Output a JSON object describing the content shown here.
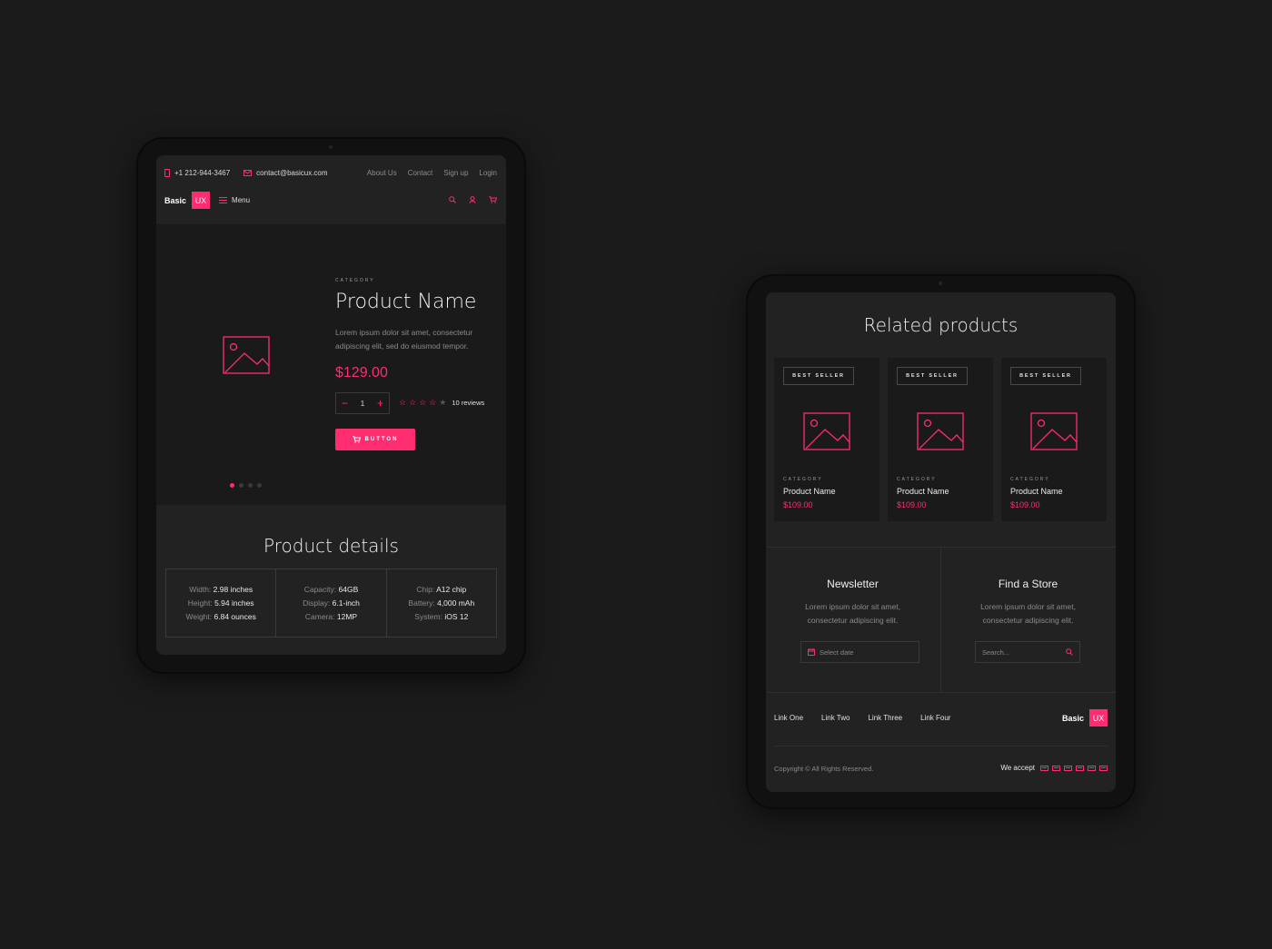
{
  "brand": {
    "basic": "Basic",
    "ux": "UX"
  },
  "accent_color": "#ff2d6f",
  "topbar": {
    "phone": "+1 212-944-3467",
    "email": "contact@basicux.com",
    "links": [
      "About Us",
      "Contact",
      "Sign up",
      "Login"
    ],
    "menu_label": "Menu",
    "icons": [
      "search-icon",
      "user-icon",
      "cart-icon"
    ]
  },
  "hero": {
    "category": "CATEGORY",
    "product_name": "Product Name",
    "description_line1": "Lorem ipsum dolor sit amet, consectetur",
    "description_line2": "adipiscing elit, sed do eiusmod tempor.",
    "price": "$129.00",
    "quantity": "1",
    "rating": 4,
    "rating_max": 5,
    "reviews": "10 reviews",
    "button_label": "BUTTON",
    "carousel_dots": 4,
    "carousel_active": 0
  },
  "details": {
    "title": "Product details",
    "columns": [
      [
        {
          "k": "Width:",
          "v": "2.98 inches"
        },
        {
          "k": "Height:",
          "v": "5.94 inches"
        },
        {
          "k": "Weight:",
          "v": "6.84 ounces"
        }
      ],
      [
        {
          "k": "Capacity:",
          "v": "64GB"
        },
        {
          "k": "Display:",
          "v": "6.1-inch"
        },
        {
          "k": "Camera:",
          "v": "12MP"
        }
      ],
      [
        {
          "k": "Chip:",
          "v": "A12 chip"
        },
        {
          "k": "Battery:",
          "v": "4,000 mAh"
        },
        {
          "k": "System:",
          "v": "iOS 12"
        }
      ]
    ]
  },
  "related": {
    "title": "Related products",
    "cards": [
      {
        "badge": "BEST SELLER",
        "category": "CATEGORY",
        "name": "Product Name",
        "price": "$109.00"
      },
      {
        "badge": "BEST SELLER",
        "category": "CATEGORY",
        "name": "Product Name",
        "price": "$109.00"
      },
      {
        "badge": "BEST SELLER",
        "category": "CATEGORY",
        "name": "Product Name",
        "price": "$109.00"
      }
    ]
  },
  "newsletter": {
    "title": "Newsletter",
    "desc_line1": "Lorem ipsum dolor sit amet,",
    "desc_line2": "consectetur adipiscing elit.",
    "input_placeholder": "Select date"
  },
  "store": {
    "title": "Find a Store",
    "desc_line1": "Lorem ipsum dolor sit amet,",
    "desc_line2": "consectetur adipiscing elit.",
    "input_placeholder": "Search..."
  },
  "footer": {
    "links": [
      "Link One",
      "Link Two",
      "Link Three",
      "Link Four"
    ],
    "copyright": "Copyright © All Rights Reserved.",
    "we_accept": "We accept",
    "payment_icons": 6
  }
}
